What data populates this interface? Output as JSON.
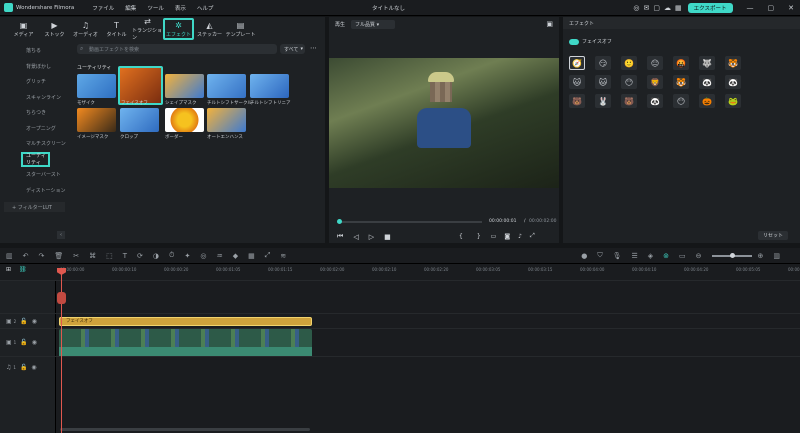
{
  "app": {
    "name": "Wondershare Filmora",
    "title": "タイトルなし",
    "export": "エクスポート"
  },
  "menu": [
    "ファイル",
    "編集",
    "ツール",
    "表示",
    "ヘルプ"
  ],
  "tools": [
    {
      "label": "メディア",
      "icon": "▣"
    },
    {
      "label": "ストック",
      "icon": "▶"
    },
    {
      "label": "オーディオ",
      "icon": "♫"
    },
    {
      "label": "タイトル",
      "icon": "T"
    },
    {
      "label": "トランジション",
      "icon": "⇄"
    },
    {
      "label": "エフェクト",
      "icon": "✲"
    },
    {
      "label": "ステッカー",
      "icon": "◭"
    },
    {
      "label": "テンプレート",
      "icon": "▤"
    }
  ],
  "nav": [
    "落ちる",
    "背景ぼかし",
    "グリッチ",
    "スキャンライン",
    "ちらつき",
    "オープニング",
    "マルチスクリーン",
    "ユーティリティ",
    "スターバースト",
    "ディストーション"
  ],
  "nav_footer": "+ フィルターLUT",
  "library": {
    "placeholder": "動画エフェクトを検索",
    "filter": "すべて",
    "section": "ユーティリティ",
    "items": [
      "モザイク",
      "フェイスオフ",
      "シェイプマスク",
      "チルトシフトサークル",
      "チルトシフトリニア",
      "イメージマスク",
      "クロップ",
      "ボーダー",
      "オートエンハンス"
    ]
  },
  "player": {
    "tab": "再生",
    "quality": "フル品質",
    "time_current": "00:00:00:01",
    "time_sep": "/",
    "time_total": "00:00:02:00"
  },
  "effects": {
    "tab": "エフェクト",
    "toggle_label": "フェイスオフ",
    "emojis": [
      "🧭",
      "😏",
      "🙂",
      "😐",
      "🤬",
      "🐺",
      "🐯",
      "🐱",
      "🐱",
      "😶",
      "🦁",
      "🐯",
      "🐼",
      "🐼",
      "🐻",
      "🐰",
      "🐻",
      "🐼",
      "😶",
      "🎃",
      "🐸"
    ],
    "reset": "リセット"
  },
  "ruler": [
    "00:00:00:00",
    "00:00:00:10",
    "00:00:00:20",
    "00:00:01:05",
    "00:00:01:15",
    "00:00:02:00",
    "00:00:02:10",
    "00:00:02:20",
    "00:00:03:05",
    "00:00:03:15",
    "00:00:04:00",
    "00:00:04:10",
    "00:00:04:20",
    "00:00:05:05",
    "00:00:05:15"
  ],
  "timeline": {
    "effect_clip": "フェイスオフ",
    "track_labels": [
      "2",
      "1",
      "1"
    ]
  }
}
